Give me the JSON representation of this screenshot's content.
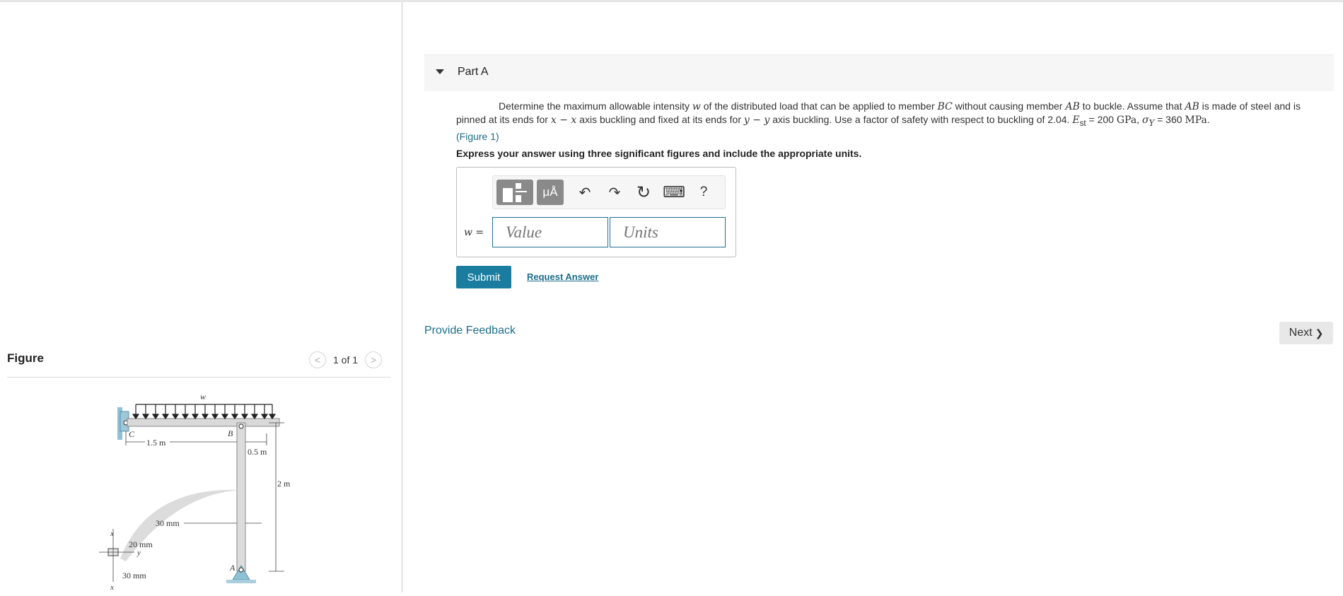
{
  "figure": {
    "title": "Figure",
    "pager_text": "1 of 1",
    "prev_glyph": "<",
    "next_glyph": ">",
    "diagram_labels": {
      "w": "w",
      "c": "C",
      "b": "B",
      "a": "A",
      "len_bc": "1.5 m",
      "len_overhang": "0.5 m",
      "len_ab": "2 m",
      "dim_30_top": "30 mm",
      "dim_20": "20 mm",
      "dim_30_bottom": "30 mm",
      "axis_x_top": "x",
      "axis_x_bottom": "x",
      "axis_y_left": "y",
      "axis_y_right": "y"
    }
  },
  "part": {
    "title": "Part A"
  },
  "problem": {
    "t1": "Determine the maximum allowable intensity ",
    "m_w": "w",
    "t2": " of the distributed load that can be applied to member ",
    "m_bc": "BC",
    "t3": " without causing member ",
    "m_ab": "AB",
    "t4": " to buckle. Assume that ",
    "m_ab2": "AB",
    "t5": " is made of steel and is pinned at its ends for ",
    "m_xx": "x − x",
    "t6": " axis buckling and fixed at its ends for ",
    "m_yy": "y − y",
    "t7": " axis buckling. Use a factor of safety with respect to buckling of 2.04. ",
    "m_est": "E",
    "m_est_sub": "st",
    "t8": " = 200 ",
    "m_gpa": "GPa",
    "t9": ", ",
    "m_sig": "σ",
    "m_sig_sub": "Y",
    "t10": " = 360 ",
    "m_mpa": "MPa",
    "t11": ".",
    "figure_link": "(Figure 1)"
  },
  "instruction": "Express your answer using three significant figures and include the appropriate units.",
  "answer": {
    "label": "w =",
    "value_placeholder": "Value",
    "units_placeholder": "Units",
    "toolbar": {
      "mu_label": "μÅ",
      "undo": "↶",
      "redo": "↷",
      "reset": "↻",
      "keyboard": "⌨",
      "help": "?"
    }
  },
  "buttons": {
    "submit": "Submit",
    "request_answer": "Request Answer",
    "provide_feedback": "Provide Feedback",
    "next": "Next",
    "next_glyph": "❯"
  },
  "colors": {
    "accent": "#1a7da0",
    "link": "#1b6d8a",
    "support": "#8fc1d6"
  }
}
